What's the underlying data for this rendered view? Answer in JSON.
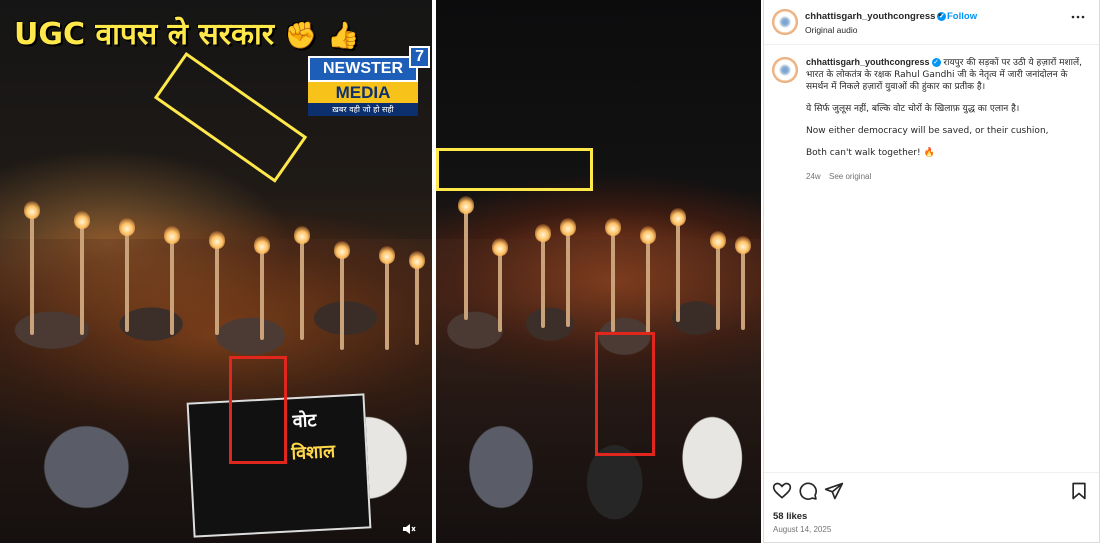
{
  "left_frame": {
    "headline": "UGC वापस ले सरकार",
    "headline_emojis": [
      "✊",
      "👍"
    ],
    "logo": {
      "top": "NEWSTER",
      "number": "7",
      "bottom": "MEDIA",
      "tagline": "ख़बर वही जो हो सही"
    },
    "banner": {
      "line1": "वोट",
      "line2": "विशाल"
    },
    "mute_icon": "speaker-muted-icon"
  },
  "post": {
    "username": "chhattisgarh_youthcongress",
    "follow_separator": "•",
    "follow_label": "Follow",
    "audio_label": "Original audio",
    "caption_username": "chhattisgarh_youthcongress",
    "caption_paragraphs": [
      "रायपुर की सड़कों पर उठी ये हज़ारों मशालें, भारत के लोकतंत्र के रक्षक Rahul Gandhi जी के नेतृत्व में जारी जनांदोलन के समर्थन में निकले हज़ारों युवाओं की हुंकार का प्रतीक है।",
      "ये सिर्फ जुलूस नहीं, बल्कि वोट चोरों के खिलाफ़ युद्ध का एलान है।",
      "Now either democracy will be saved, or their cushion,",
      "Both can't walk together! 🔥"
    ],
    "age": "24w",
    "see_original": "See original",
    "likes": "58 likes",
    "date": "August 14, 2025"
  },
  "colors": {
    "highlight_yellow": "#ffe94a",
    "highlight_red": "#e0261d",
    "instagram_blue": "#0095f6",
    "text_dark": "#262626",
    "text_muted": "#737373"
  }
}
